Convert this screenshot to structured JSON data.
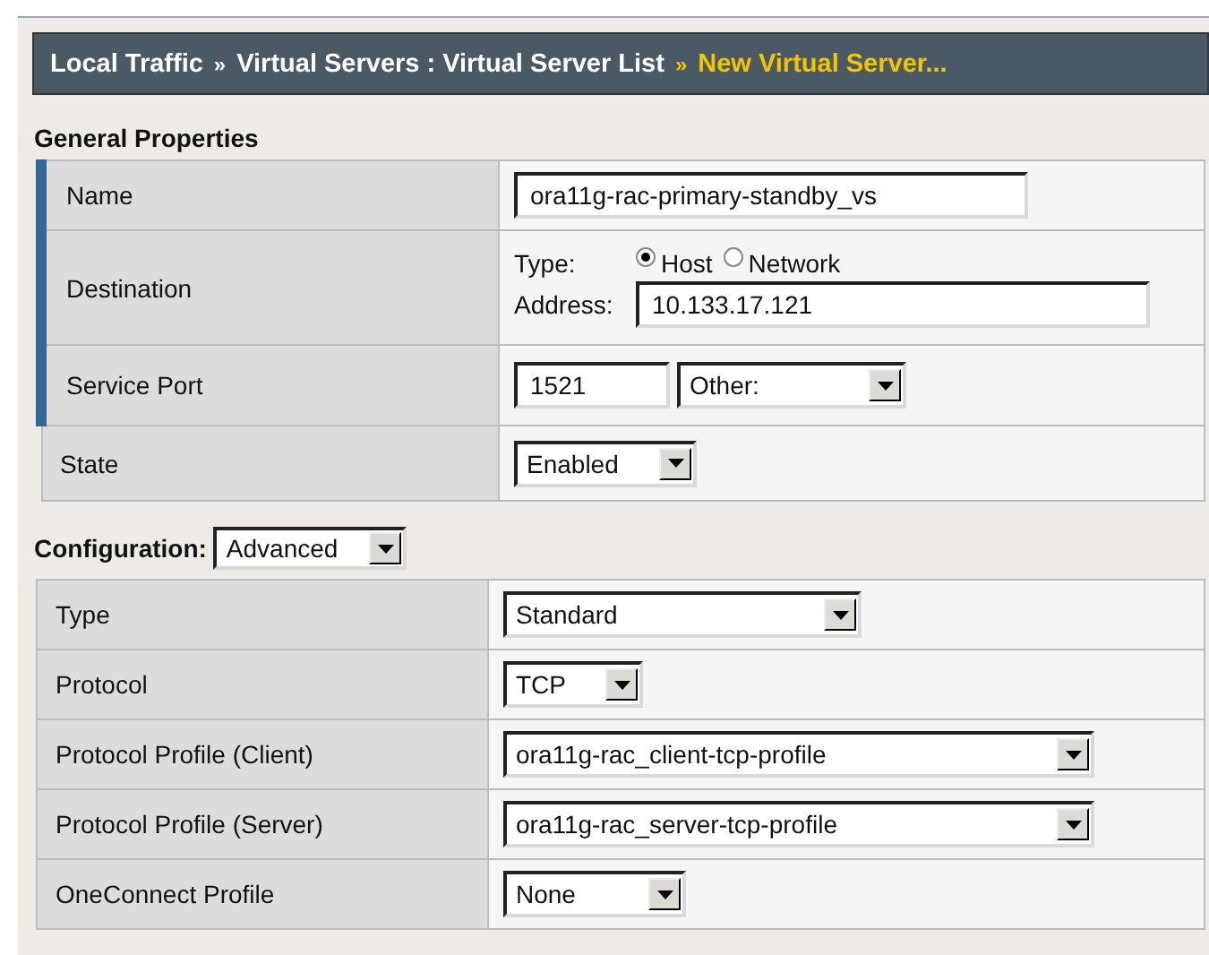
{
  "breadcrumb": [
    {
      "kind": "link",
      "text": "Local Traffic"
    },
    {
      "kind": "sep",
      "text": "»"
    },
    {
      "kind": "link",
      "text": "Virtual Servers : Virtual Server List"
    },
    {
      "kind": "sep",
      "text": "»"
    },
    {
      "kind": "current",
      "text": "New Virtual Server..."
    }
  ],
  "general": {
    "title": "General Properties",
    "rows": [
      {
        "label": "Name",
        "required": true,
        "kind": "text",
        "value": "ora11g-rac-primary-standby_vs"
      },
      {
        "label": "Destination",
        "required": true,
        "kind": "destination",
        "type_label": "Type:",
        "options": [
          {
            "label": "Host",
            "selected": true
          },
          {
            "label": "Network",
            "selected": false
          }
        ],
        "address_label": "Address:",
        "address": "10.133.17.121"
      },
      {
        "label": "Service Port",
        "required": true,
        "kind": "port",
        "port": "1521",
        "service": "Other:"
      },
      {
        "label": "State",
        "required": false,
        "kind": "select",
        "value": "Enabled"
      }
    ]
  },
  "configuration": {
    "label": "Configuration:",
    "mode": "Advanced",
    "rows": [
      {
        "label": "Type",
        "value": "Standard"
      },
      {
        "label": "Protocol",
        "value": "TCP"
      },
      {
        "label": "Protocol Profile (Client)",
        "value": "ora11g-rac_client-tcp-profile"
      },
      {
        "label": "Protocol Profile (Server)",
        "value": "ora11g-rac_server-tcp-profile"
      },
      {
        "label": "OneConnect Profile",
        "value": "None"
      }
    ]
  }
}
